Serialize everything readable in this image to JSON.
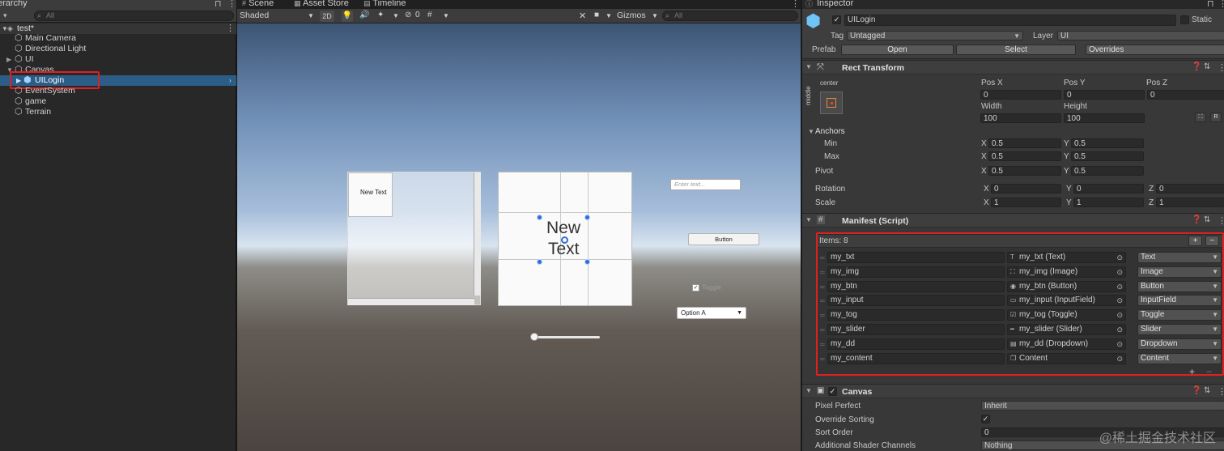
{
  "hierarchy": {
    "title": "erarchy",
    "search_placeholder": "All",
    "scene_name": "test*",
    "items": [
      {
        "label": "Main Camera"
      },
      {
        "label": "Directional Light"
      },
      {
        "label": "UI"
      },
      {
        "label": "Canvas"
      },
      {
        "label": "UILogin"
      },
      {
        "label": "EventSystem"
      },
      {
        "label": "game"
      },
      {
        "label": "Terrain"
      }
    ]
  },
  "scene": {
    "tabs": [
      {
        "label": "Scene",
        "icon": "grid-icon"
      },
      {
        "label": "Asset Store",
        "icon": "store-icon"
      },
      {
        "label": "Timeline",
        "icon": "timeline-icon"
      }
    ],
    "toolbar": {
      "shading_mode": "Shaded",
      "mode_2d": "2D",
      "hidden_count": "0",
      "gizmos_label": "Gizmos",
      "search_placeholder": "All"
    },
    "ui_preview": {
      "scroll_text": "New Text",
      "big_text_line1": "New",
      "big_text_line2": "Text",
      "input_placeholder": "Enter text...",
      "button_label": "Button",
      "toggle_label": "Toggle",
      "dropdown_value": "Option A"
    }
  },
  "inspector": {
    "title": "Inspector",
    "object_name": "UILogin",
    "static_label": "Static",
    "tag_label": "Tag",
    "tag_value": "Untagged",
    "layer_label": "Layer",
    "layer_value": "UI",
    "prefab_label": "Prefab",
    "prefab_open": "Open",
    "prefab_select": "Select",
    "prefab_overrides": "Overrides",
    "rect_transform": {
      "title": "Rect Transform",
      "anchor_h": "center",
      "anchor_v": "middle",
      "pos_x_label": "Pos X",
      "pos_x": "0",
      "pos_y_label": "Pos Y",
      "pos_y": "0",
      "pos_z_label": "Pos Z",
      "pos_z": "0",
      "width_label": "Width",
      "width": "100",
      "height_label": "Height",
      "height": "100",
      "blueprint_btn": "R",
      "anchors_label": "Anchors",
      "min_label": "Min",
      "min_x": "0.5",
      "min_y": "0.5",
      "max_label": "Max",
      "max_x": "0.5",
      "max_y": "0.5",
      "pivot_label": "Pivot",
      "pivot_x": "0.5",
      "pivot_y": "0.5",
      "rotation_label": "Rotation",
      "rot_x": "0",
      "rot_y": "0",
      "rot_z": "0",
      "scale_label": "Scale",
      "scale_x": "1",
      "scale_y": "1",
      "scale_z": "1",
      "x_letter": "X",
      "y_letter": "Y",
      "z_letter": "Z"
    },
    "manifest": {
      "title": "Manifest (Script)",
      "items_label": "Items: 8",
      "add_btn": "+",
      "remove_btn": "−",
      "rows": [
        {
          "name": "my_txt",
          "object": "my_txt (Text)",
          "type": "Text",
          "icon": "T"
        },
        {
          "name": "my_img",
          "object": "my_img (Image)",
          "type": "Image",
          "icon": "⛶"
        },
        {
          "name": "my_btn",
          "object": "my_btn (Button)",
          "type": "Button",
          "icon": "◉"
        },
        {
          "name": "my_input",
          "object": "my_input (InputField)",
          "type": "InputField",
          "icon": "▭"
        },
        {
          "name": "my_tog",
          "object": "my_tog (Toggle)",
          "type": "Toggle",
          "icon": "☑"
        },
        {
          "name": "my_slider",
          "object": "my_slider (Slider)",
          "type": "Slider",
          "icon": "━"
        },
        {
          "name": "my_dd",
          "object": "my_dd (Dropdown)",
          "type": "Dropdown",
          "icon": "▤"
        },
        {
          "name": "my_content",
          "object": "Content",
          "type": "Content",
          "icon": "❒"
        }
      ]
    },
    "canvas": {
      "title": "Canvas",
      "pixel_perfect_label": "Pixel Perfect",
      "pixel_perfect_value": "Inherit",
      "override_sorting_label": "Override Sorting",
      "override_sorting_value": "✓",
      "sort_order_label": "Sort Order",
      "sort_order_value": "0",
      "shader_channels_label": "Additional Shader Channels",
      "shader_channels_value": "Nothing"
    },
    "watermark": "@稀土掘金技术社区"
  }
}
